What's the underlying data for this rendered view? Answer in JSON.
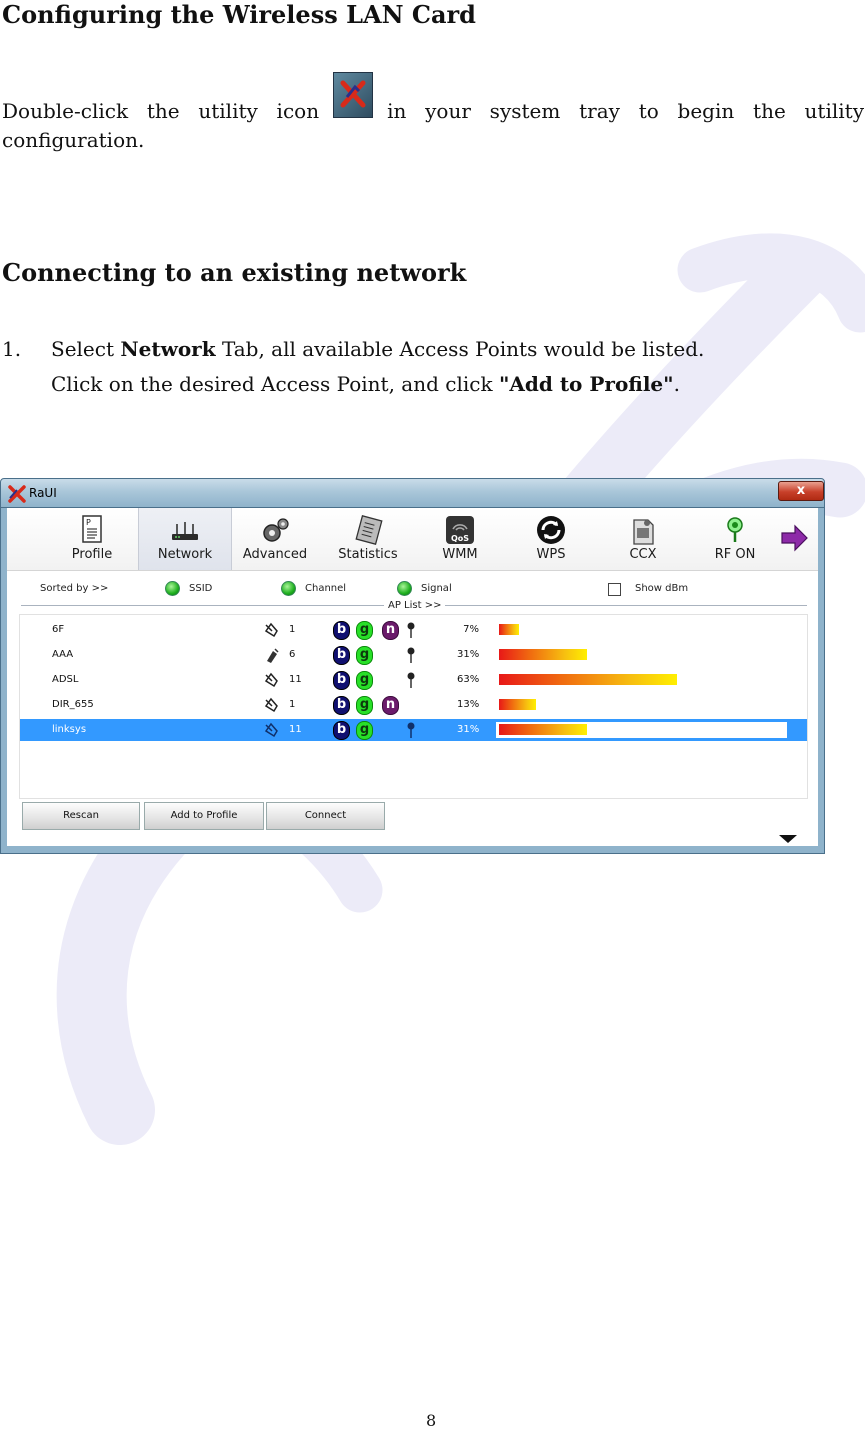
{
  "heading1": "Configuring the Wireless LAN Card",
  "para1": {
    "before_icon": "Double-click the utility icon",
    "after_icon": "in your system tray to begin the utility",
    "line2": "configuration."
  },
  "heading2": "Connecting to an existing network",
  "step1": {
    "number": "1.",
    "select": "Select",
    "network_bold": "Network",
    "rest": "Tab, all available Access Points would be listed.",
    "line2_pre": "Click on the desired Access Point, and click ",
    "line2_bold": "\"Add to Profile\"",
    "line2_post": "."
  },
  "window": {
    "title": "RaUI",
    "close": "x",
    "toolbar": [
      {
        "label": "Profile",
        "icon": "profile-icon"
      },
      {
        "label": "Network",
        "icon": "network-icon"
      },
      {
        "label": "Advanced",
        "icon": "advanced-icon"
      },
      {
        "label": "Statistics",
        "icon": "statistics-icon"
      },
      {
        "label": "WMM",
        "icon": "wmm-icon"
      },
      {
        "label": "WPS",
        "icon": "wps-icon"
      },
      {
        "label": "CCX",
        "icon": "ccx-icon"
      },
      {
        "label": "RF ON",
        "icon": "rf-icon"
      }
    ],
    "wmm_badge": "QoS",
    "sorted_by": "Sorted by >>",
    "sort_ssid": "SSID",
    "sort_channel": "Channel",
    "sort_signal": "Signal",
    "show_dbm": "Show dBm",
    "ap_list_label": "AP List >>",
    "aps": [
      {
        "ssid": "6F",
        "channel": "1",
        "b": "b",
        "g": "g",
        "n": "n",
        "secured": true,
        "signal": "7%",
        "level": 7
      },
      {
        "ssid": "AAA",
        "channel": "6",
        "b": "b",
        "g": "g",
        "n": "",
        "secured": true,
        "signal": "31%",
        "level": 31
      },
      {
        "ssid": "ADSL",
        "channel": "11",
        "b": "b",
        "g": "g",
        "n": "",
        "secured": true,
        "signal": "63%",
        "level": 63
      },
      {
        "ssid": "DIR_655",
        "channel": "1",
        "b": "b",
        "g": "g",
        "n": "n",
        "secured": false,
        "signal": "13%",
        "level": 13
      },
      {
        "ssid": "linksys",
        "channel": "11",
        "b": "b",
        "g": "g",
        "n": "",
        "secured": true,
        "signal": "31%",
        "level": 31
      }
    ],
    "buttons": {
      "rescan": "Rescan",
      "add_to_profile": "Add to Profile",
      "connect": "Connect"
    }
  },
  "page_number": "8",
  "colors": {
    "selection": "#3399ff",
    "signal_low": "#e81818",
    "signal_high": "#ffef00"
  }
}
